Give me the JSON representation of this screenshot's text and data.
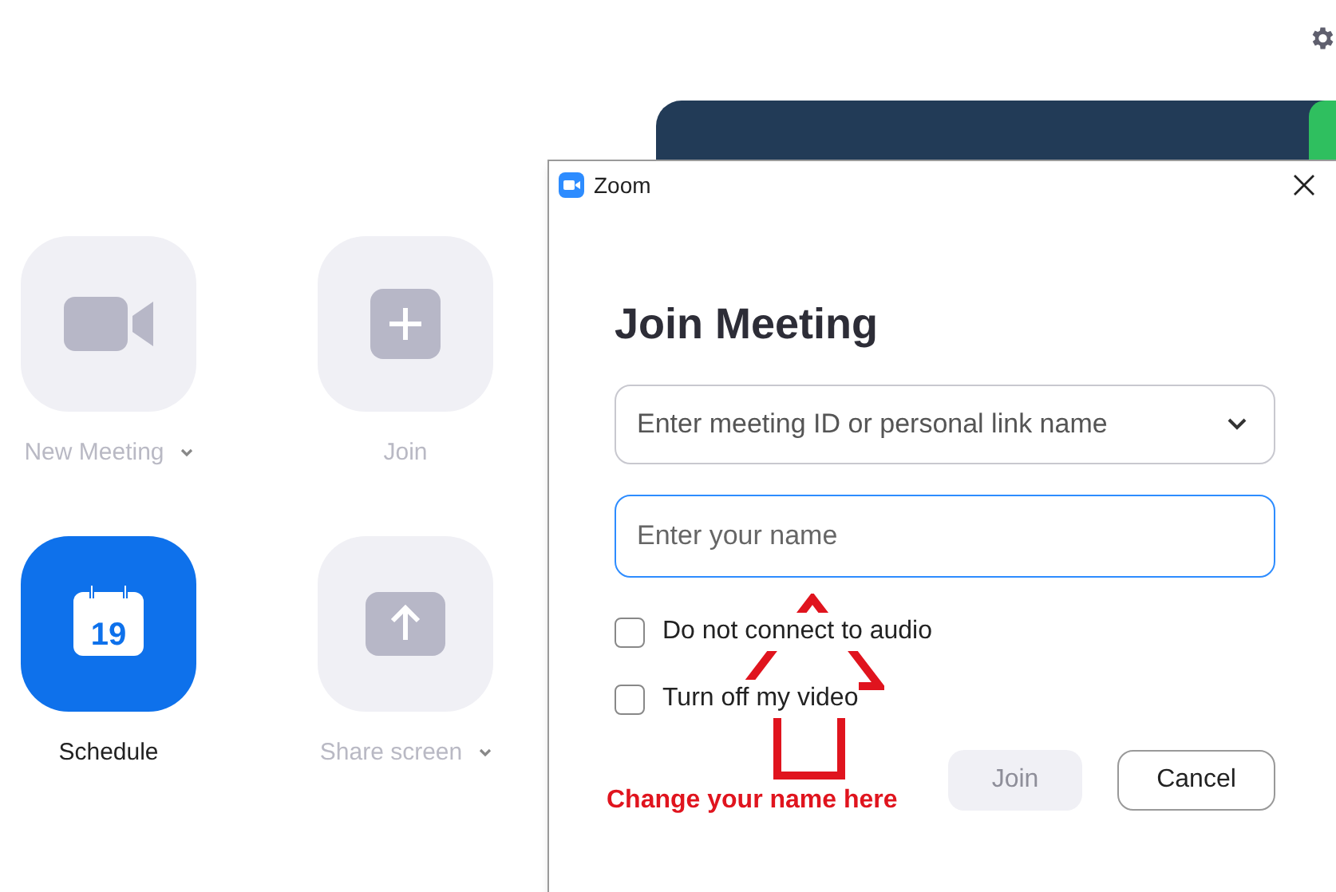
{
  "home": {
    "tiles": [
      {
        "kind": "video",
        "label": "New Meeting",
        "disabled": true,
        "menu": true
      },
      {
        "kind": "plus",
        "label": "Join",
        "disabled": true,
        "menu": false
      },
      {
        "kind": "calendar",
        "label": "Schedule",
        "icon_text": "19",
        "disabled": false,
        "menu": false
      },
      {
        "kind": "share",
        "label": "Share screen",
        "disabled": true,
        "menu": true
      }
    ]
  },
  "dialog": {
    "title": "Zoom",
    "heading": "Join Meeting",
    "meeting_field": {
      "placeholder": "Enter meeting ID or personal link name"
    },
    "name_field": {
      "placeholder": "Enter your name",
      "focused": true
    },
    "options": [
      {
        "label": "Do not connect to audio",
        "checked": false
      },
      {
        "label": "Turn off my video",
        "checked": false
      }
    ],
    "buttons": [
      {
        "label": "Join",
        "kind": "primary",
        "disabled": true
      },
      {
        "label": "Cancel",
        "kind": "secondary",
        "disabled": false
      }
    ]
  },
  "annotation": {
    "text": "Change your name here"
  }
}
